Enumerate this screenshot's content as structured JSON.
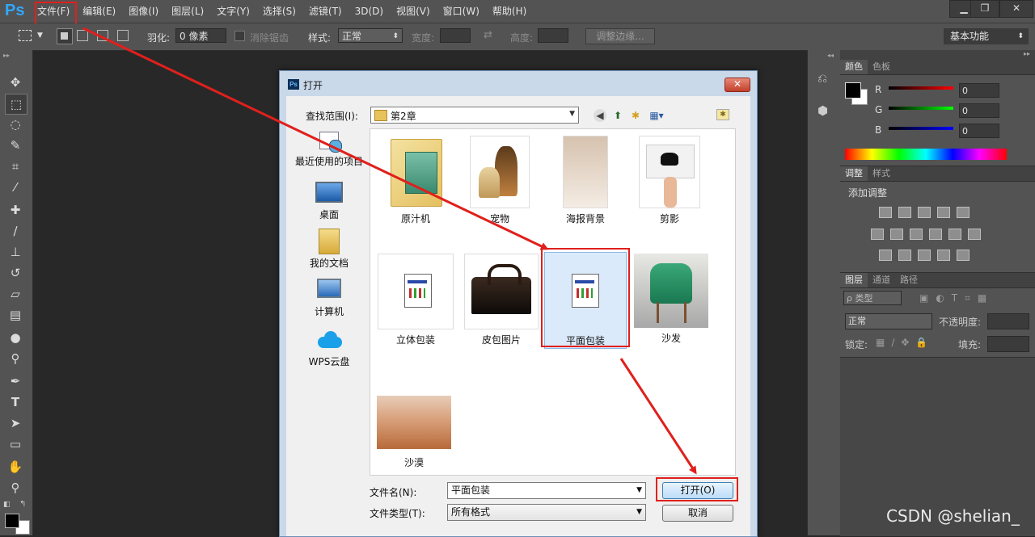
{
  "app": {
    "logo": "Ps"
  },
  "menu": [
    {
      "label": "文件(F)"
    },
    {
      "label": "编辑(E)"
    },
    {
      "label": "图像(I)"
    },
    {
      "label": "图层(L)"
    },
    {
      "label": "文字(Y)"
    },
    {
      "label": "选择(S)"
    },
    {
      "label": "滤镜(T)"
    },
    {
      "label": "3D(D)"
    },
    {
      "label": "视图(V)"
    },
    {
      "label": "窗口(W)"
    },
    {
      "label": "帮助(H)"
    }
  ],
  "window_controls": {
    "minimize": "▁",
    "restore": "❐",
    "close": "✕"
  },
  "options": {
    "feather_label": "羽化:",
    "feather_value": "0 像素",
    "antialias_label": "消除锯齿",
    "style_label": "样式:",
    "style_value": "正常",
    "width_label": "宽度:",
    "height_label": "高度:",
    "refine_edge": "调整边缘...",
    "workspace": "基本功能"
  },
  "color_panel": {
    "tabs": [
      "颜色",
      "色板"
    ],
    "channels": [
      {
        "label": "R",
        "value": "0"
      },
      {
        "label": "G",
        "value": "0"
      },
      {
        "label": "B",
        "value": "0"
      }
    ]
  },
  "adjust_panel": {
    "tabs": [
      "调整",
      "样式"
    ],
    "title": "添加调整"
  },
  "layers_panel": {
    "tabs": [
      "图层",
      "通道",
      "路径"
    ],
    "kind_label": "ρ 类型",
    "blend_mode": "正常",
    "opacity_label": "不透明度:",
    "lock_label": "锁定:",
    "fill_label": "填充:"
  },
  "dialog": {
    "title": "打开",
    "title_icon": "Ps",
    "close": "✕",
    "lookin_label": "查找范围(I):",
    "lookin_value": "第2章",
    "places": [
      {
        "label": "最近使用的项目",
        "icon": "recent-items-icon"
      },
      {
        "label": "桌面",
        "icon": "desktop-icon"
      },
      {
        "label": "我的文档",
        "icon": "documents-icon"
      },
      {
        "label": "计算机",
        "icon": "computer-icon"
      },
      {
        "label": "WPS云盘",
        "icon": "cloud-icon"
      }
    ],
    "files": [
      {
        "label": "原汁机"
      },
      {
        "label": "宠物"
      },
      {
        "label": "海报背景"
      },
      {
        "label": "剪影"
      },
      {
        "label": "立体包装"
      },
      {
        "label": "皮包图片"
      },
      {
        "label": "平面包装"
      },
      {
        "label": "沙发"
      },
      {
        "label": "沙漠"
      }
    ],
    "filename_label": "文件名(N):",
    "filename_value": "平面包装",
    "filetype_label": "文件类型(T):",
    "filetype_value": "所有格式",
    "open_button": "打开(O)",
    "cancel_button": "取消"
  },
  "watermark": "CSDN @shelian_",
  "colors": {
    "annotation_red": "#e0201c",
    "ps_blue": "#31a8ff"
  }
}
